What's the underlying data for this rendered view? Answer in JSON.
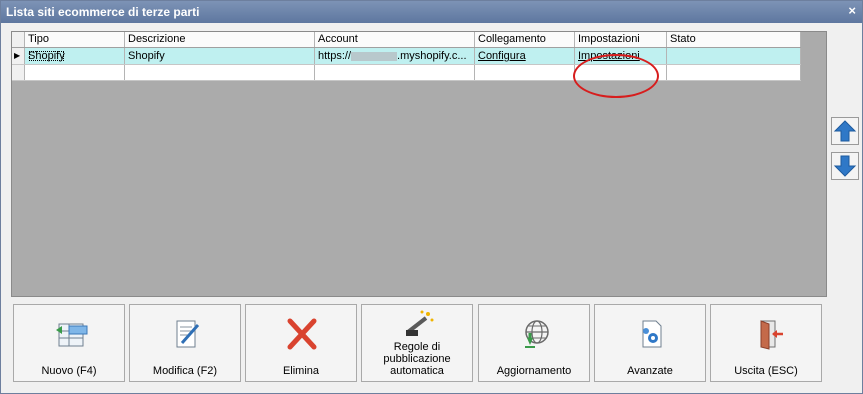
{
  "window": {
    "title": "Lista siti ecommerce di terze parti",
    "close_glyph": "×"
  },
  "table": {
    "columns": [
      "Tipo",
      "Descrizione",
      "Account",
      "Collegamento",
      "Impostazioni",
      "Stato"
    ],
    "rows": [
      {
        "tipo": "Shopify",
        "descrizione": "Shopify",
        "account_prefix": "https://",
        "account_suffix": ".myshopify.c...",
        "collegamento": "Configura",
        "impostazioni": "Impostazioni",
        "stato": ""
      }
    ],
    "row_indicator": "▶"
  },
  "side": {
    "up_icon": "arrow-up-icon",
    "down_icon": "arrow-down-icon",
    "arrow_color": "#2f78c7"
  },
  "buttons": [
    {
      "label": "Nuovo (F4)",
      "icon": "new-record-icon"
    },
    {
      "label": "Modifica (F2)",
      "icon": "edit-document-icon"
    },
    {
      "label": "Elimina",
      "icon": "delete-x-icon"
    },
    {
      "label": "Regole di\npubblicazione\nautomatica",
      "icon": "magic-wand-icon"
    },
    {
      "label": "Aggiornamento",
      "icon": "globe-download-icon"
    },
    {
      "label": "Avanzate",
      "icon": "document-gear-icon"
    },
    {
      "label": "Uscita (ESC)",
      "icon": "exit-door-icon"
    }
  ],
  "colors": {
    "selected_row": "#bff0f0",
    "highlight_ring": "#d71d1d",
    "delete": "#d9432f"
  }
}
